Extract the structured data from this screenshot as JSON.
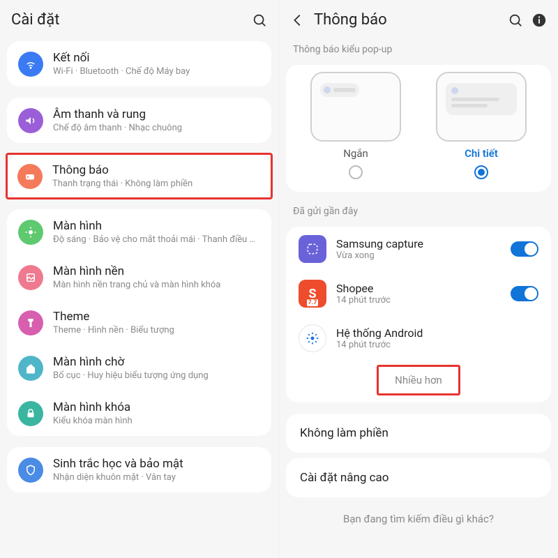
{
  "left": {
    "title": "Cài đặt",
    "items": [
      {
        "title": "Kết nối",
        "sub": "Wi-Fi · Bluetooth · Chế độ Máy bay"
      },
      {
        "title": "Âm thanh và rung",
        "sub": "Chế độ âm thanh · Nhạc chuông"
      },
      {
        "title": "Thông báo",
        "sub": "Thanh trạng thái · Không làm phiền"
      },
      {
        "title": "Màn hình",
        "sub": "Độ sáng · Bảo vệ cho mắt thoải mái · Thanh điều hướng"
      },
      {
        "title": "Màn hình nền",
        "sub": "Màn hình nền trang chủ và màn hình khóa"
      },
      {
        "title": "Theme",
        "sub": "Theme · Hình nền · Biểu tượng"
      },
      {
        "title": "Màn hình chờ",
        "sub": "Bố cục · Huy hiệu biểu tượng ứng dụng"
      },
      {
        "title": "Màn hình khóa",
        "sub": "Kiểu khóa màn hình"
      },
      {
        "title": "Sinh trắc học và bảo mật",
        "sub": "Nhận diện khuôn mặt · Vân tay"
      }
    ]
  },
  "right": {
    "title": "Thông báo",
    "popup_section": "Thông báo kiểu pop-up",
    "popup_short": "Ngắn",
    "popup_detail": "Chi tiết",
    "recent_section": "Đã gửi gần đây",
    "recent": [
      {
        "title": "Samsung capture",
        "sub": "Vừa xong"
      },
      {
        "title": "Shopee",
        "sub": "14 phút trước"
      },
      {
        "title": "Hệ thống Android",
        "sub": "14 phút trước"
      }
    ],
    "more": "Nhiều hơn",
    "dnd": "Không làm phiền",
    "advanced": "Cài đặt nâng cao",
    "bottom_hint": "Bạn đang tìm kiếm điều gì khác?"
  }
}
